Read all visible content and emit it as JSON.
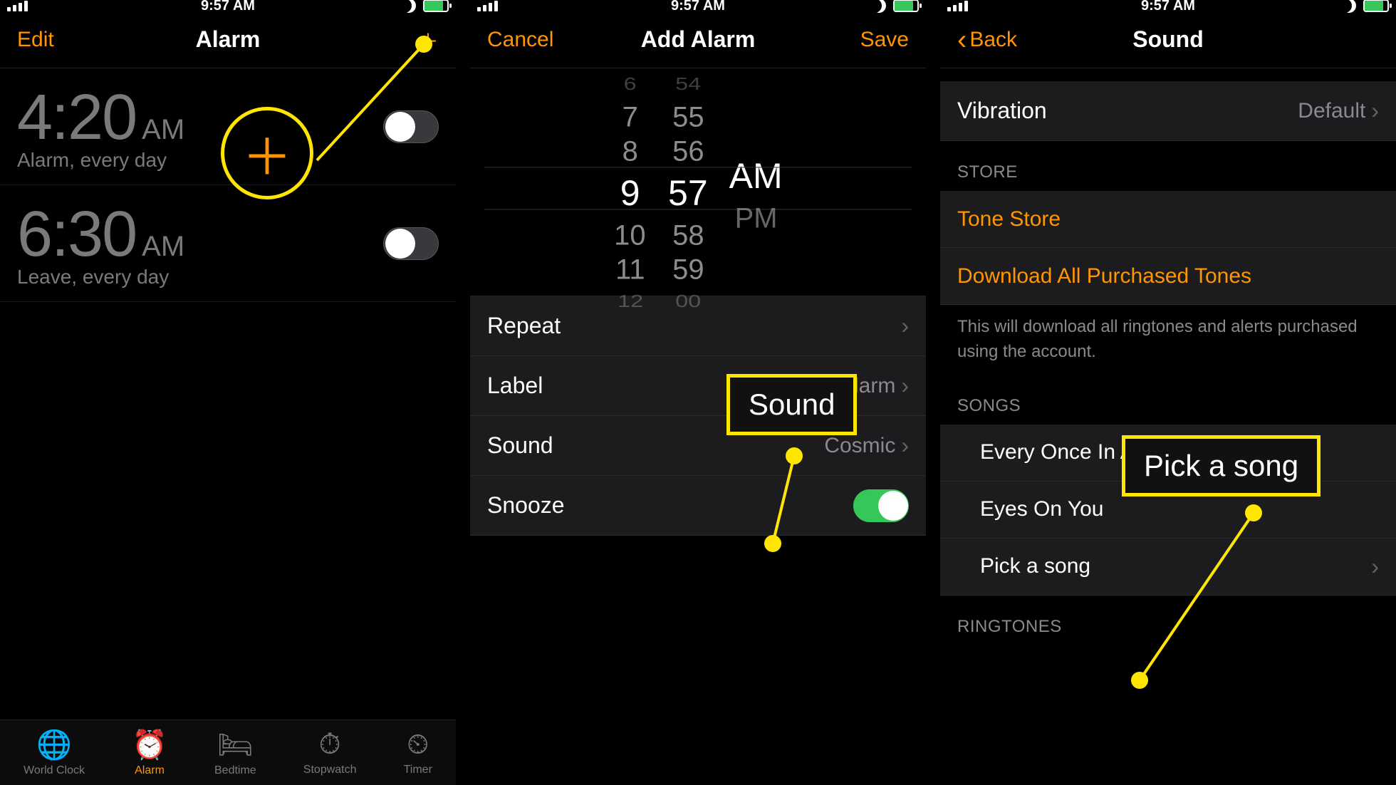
{
  "colors": {
    "accent": "#ff9500",
    "highlight": "#ffe600",
    "switch_on": "#35c759"
  },
  "status": {
    "time": "9:57 AM"
  },
  "screen1": {
    "nav": {
      "left": "Edit",
      "title": "Alarm"
    },
    "alarms": [
      {
        "time": "4:20",
        "ampm": "AM",
        "sub": "Alarm, every day",
        "enabled": false
      },
      {
        "time": "6:30",
        "ampm": "AM",
        "sub": "Leave, every day",
        "enabled": false
      }
    ],
    "tabs": [
      {
        "label": "World Clock"
      },
      {
        "label": "Alarm"
      },
      {
        "label": "Bedtime"
      },
      {
        "label": "Stopwatch"
      },
      {
        "label": "Timer"
      }
    ],
    "active_tab": 1
  },
  "screen2": {
    "nav": {
      "left": "Cancel",
      "title": "Add Alarm",
      "right": "Save"
    },
    "picker": {
      "hours": [
        "6",
        "7",
        "8",
        "9",
        "10",
        "11",
        "12"
      ],
      "minutes": [
        "54",
        "55",
        "56",
        "57",
        "58",
        "59",
        "00"
      ],
      "ampm_top": "AM",
      "ampm_bottom": "PM",
      "selected_hour": "9",
      "selected_minute": "57",
      "selected_ampm": "AM"
    },
    "rows": {
      "repeat_label": "Repeat",
      "label_label": "Label",
      "label_value": "Alarm",
      "sound_label": "Sound",
      "sound_value": "Cosmic",
      "snooze_label": "Snooze",
      "snooze_on": true
    }
  },
  "screen3": {
    "nav": {
      "back": "Back",
      "title": "Sound"
    },
    "vibration": {
      "label": "Vibration",
      "value": "Default"
    },
    "store_header": "STORE",
    "tone_store": "Tone Store",
    "download_all": "Download All Purchased Tones",
    "download_note": "This will download all ringtones and alerts purchased using the account.",
    "songs_header": "SONGS",
    "songs": [
      "Every Once In A While",
      "Eyes On You",
      "Pick a song"
    ],
    "ringtones_header": "RINGTONES"
  },
  "annotations": {
    "sound_callout": "Sound",
    "pick_song_callout": "Pick a song"
  }
}
